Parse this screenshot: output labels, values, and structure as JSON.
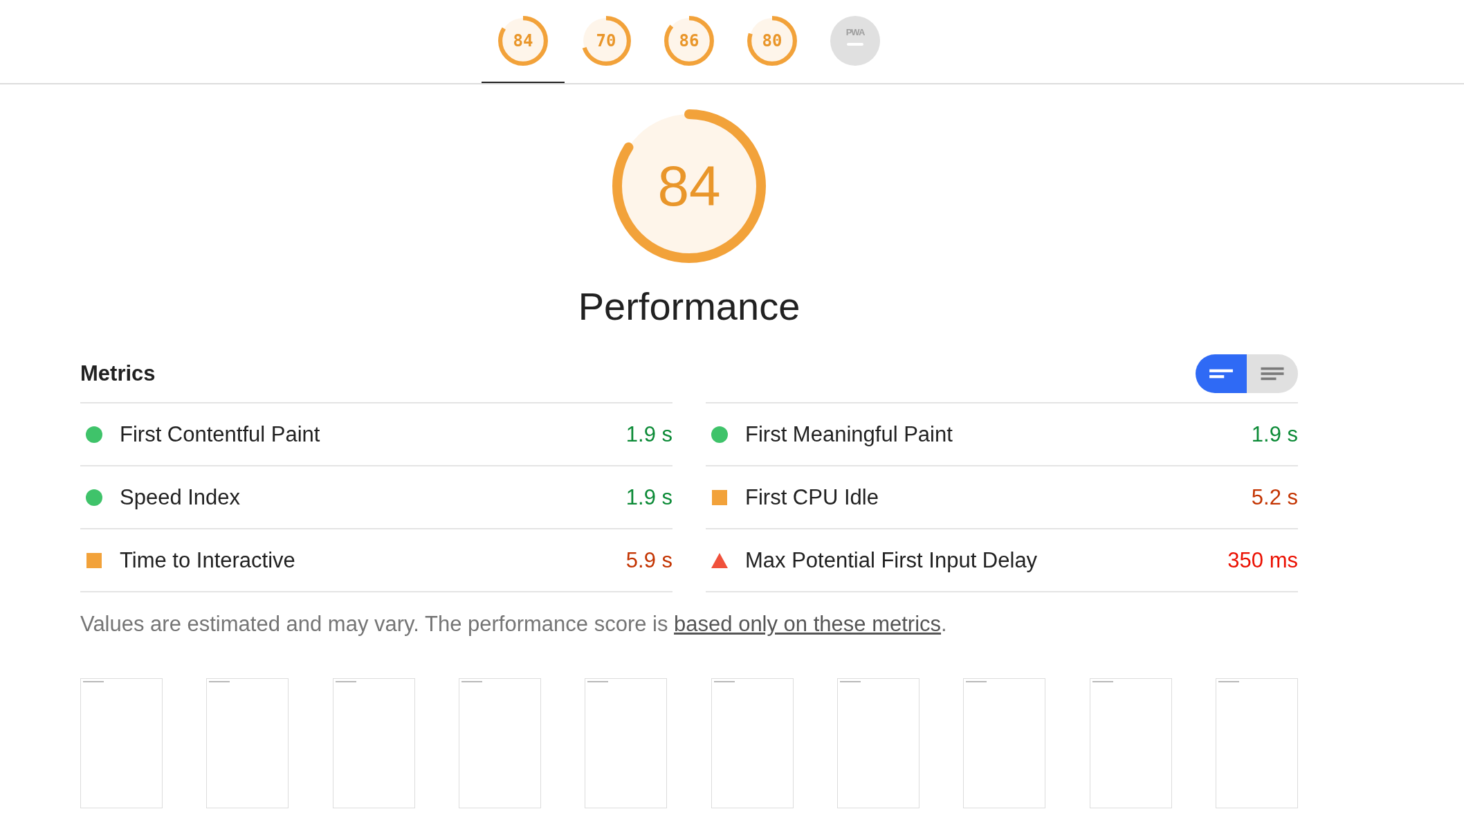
{
  "gauges": [
    {
      "kind": "score",
      "score": "84",
      "level": 0.84,
      "selected": true
    },
    {
      "kind": "score",
      "score": "70",
      "level": 0.7,
      "selected": false
    },
    {
      "kind": "score",
      "score": "86",
      "level": 0.86,
      "selected": false
    },
    {
      "kind": "score",
      "score": "80",
      "level": 0.8,
      "selected": false
    },
    {
      "kind": "pwa",
      "score": "PWA",
      "selected": false
    }
  ],
  "category": {
    "score": "84",
    "level": 0.84,
    "title": "Performance"
  },
  "metrics": {
    "heading": "Metrics",
    "view_toggle": [
      {
        "kind": "compact",
        "selected": true
      },
      {
        "kind": "list",
        "selected": false
      }
    ],
    "items": [
      {
        "label": "First Contentful Paint",
        "value": "1.9 s",
        "kind": "pass"
      },
      {
        "label": "First Meaningful Paint",
        "value": "1.9 s",
        "kind": "pass"
      },
      {
        "label": "Speed Index",
        "value": "1.9 s",
        "kind": "pass"
      },
      {
        "label": "First CPU Idle",
        "value": "5.2 s",
        "kind": "average"
      },
      {
        "label": "Time to Interactive",
        "value": "5.9 s",
        "kind": "average"
      },
      {
        "label": "Max Potential First Input Delay",
        "value": "350 ms",
        "kind": "fail"
      }
    ],
    "note": "Values are estimated and may vary. The performance score is ",
    "note_link": "based only on these metrics",
    "note_end": "."
  }
}
